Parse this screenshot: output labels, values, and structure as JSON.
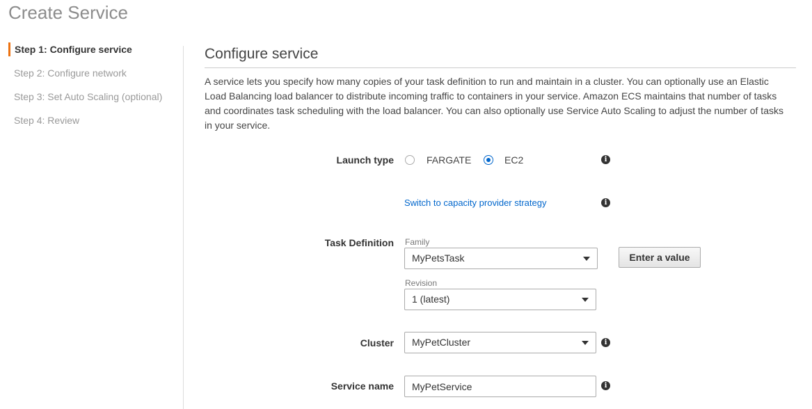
{
  "page": {
    "title": "Create Service"
  },
  "steps": [
    {
      "label": "Step 1: Configure service",
      "active": true
    },
    {
      "label": "Step 2: Configure network",
      "active": false
    },
    {
      "label": "Step 3: Set Auto Scaling (optional)",
      "active": false
    },
    {
      "label": "Step 4: Review",
      "active": false
    }
  ],
  "section": {
    "title": "Configure service",
    "description": "A service lets you specify how many copies of your task definition to run and maintain in a cluster. You can optionally use an Elastic Load Balancing load balancer to distribute incoming traffic to containers in your service. Amazon ECS maintains that number of tasks and coordinates task scheduling with the load balancer. You can also optionally use Service Auto Scaling to adjust the number of tasks in your service."
  },
  "form": {
    "launch_type": {
      "label": "Launch type",
      "options": [
        "FARGATE",
        "EC2"
      ],
      "selected": "EC2"
    },
    "capacity_link": "Switch to capacity provider strategy",
    "task_definition": {
      "label": "Task Definition",
      "family_label": "Family",
      "family_value": "MyPetsTask",
      "revision_label": "Revision",
      "revision_value": "1 (latest)",
      "enter_value_button": "Enter a value"
    },
    "cluster": {
      "label": "Cluster",
      "value": "MyPetCluster"
    },
    "service_name": {
      "label": "Service name",
      "value": "MyPetService"
    }
  },
  "icons": {
    "info": "info-icon",
    "dropdown": "chevron-down-icon"
  },
  "colors": {
    "accent": "#ec7211",
    "link": "#0066cc",
    "radio_selected": "#0066cc"
  }
}
